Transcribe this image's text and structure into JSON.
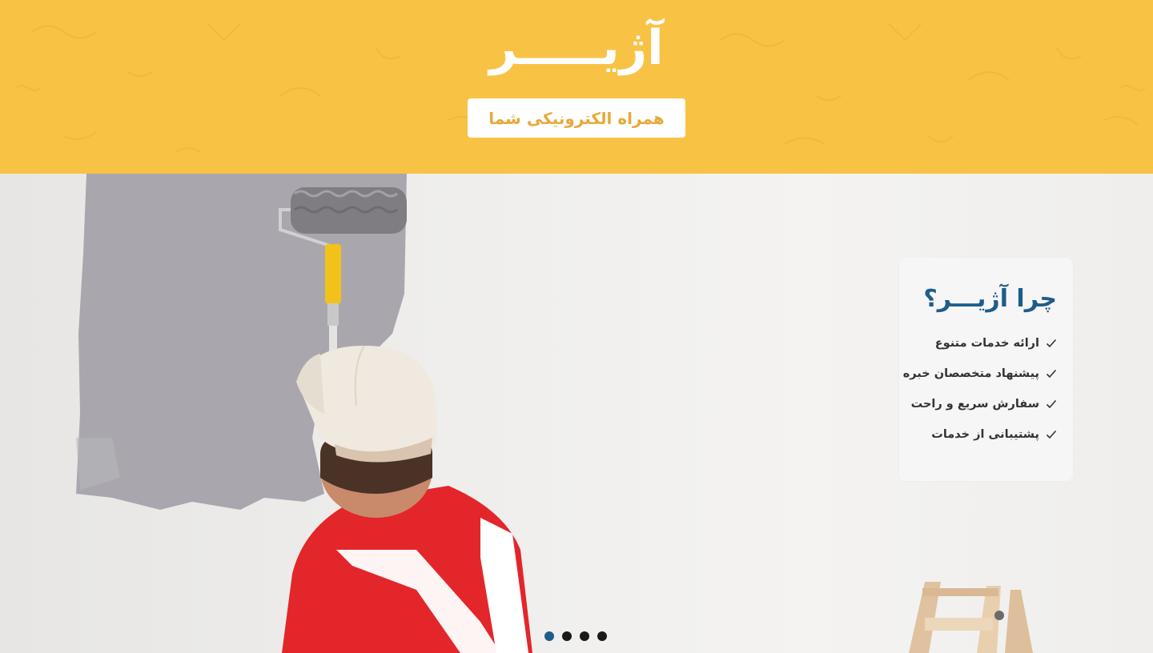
{
  "brand": {
    "logo_text": "آژیـــــر",
    "tagline": "همراه الکترونیکی شما"
  },
  "why": {
    "title": "چرا آژیـــر؟",
    "items": [
      "ارائه خدمات متنوع",
      "پیشنهاد متخصصان خبره",
      "سفارش سریع و راحت",
      "پشتیبانی از خدمات"
    ]
  },
  "slider": {
    "slide_count": 4,
    "active_index": 0
  },
  "colors": {
    "header_bg": "#f8c245",
    "tagline_text": "#e7a93a",
    "title_blue": "#1f5c8a",
    "active_dot": "#1f5c8a"
  },
  "hero_image": {
    "icons": [
      "paint-roller",
      "painter-person",
      "ladder"
    ]
  }
}
